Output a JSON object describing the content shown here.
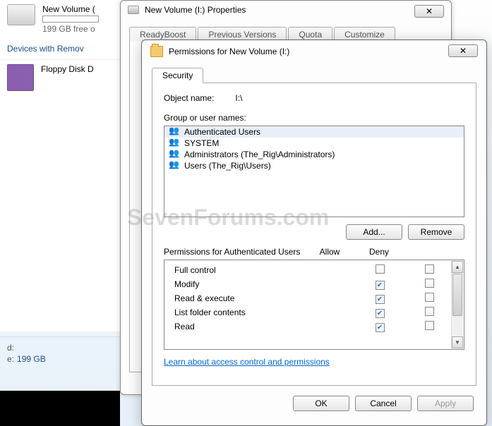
{
  "explorer": {
    "drive_name": "New Volume (",
    "drive_free": "199 GB free o",
    "section": "Devices with Remov",
    "floppy": "Floppy Disk D",
    "footer_d_label": "d:",
    "footer_d_val": "",
    "footer_e_label": "e:",
    "footer_e_val": "199 GB"
  },
  "props": {
    "title": "New Volume (I:) Properties",
    "tabs": [
      "ReadyBoost",
      "Previous Versions",
      "Quota",
      "Customize"
    ]
  },
  "perm": {
    "title": "Permissions for New Volume (I:)",
    "tab": "Security",
    "object_label": "Object name:",
    "object_value": "I:\\",
    "group_label": "Group or user names:",
    "groups": [
      "Authenticated Users",
      "SYSTEM",
      "Administrators (The_Rig\\Administrators)",
      "Users (The_Rig\\Users)"
    ],
    "add": "Add...",
    "remove": "Remove",
    "perm_for": "Permissions for Authenticated Users",
    "allow": "Allow",
    "deny": "Deny",
    "rows": [
      {
        "name": "Full control",
        "allow": false,
        "deny": false
      },
      {
        "name": "Modify",
        "allow": true,
        "deny": false
      },
      {
        "name": "Read & execute",
        "allow": true,
        "deny": false
      },
      {
        "name": "List folder contents",
        "allow": true,
        "deny": false
      },
      {
        "name": "Read",
        "allow": true,
        "deny": false
      }
    ],
    "link": "Learn about access control and permissions",
    "ok": "OK",
    "cancel": "Cancel",
    "apply": "Apply"
  },
  "watermark": "SevenForums.com"
}
